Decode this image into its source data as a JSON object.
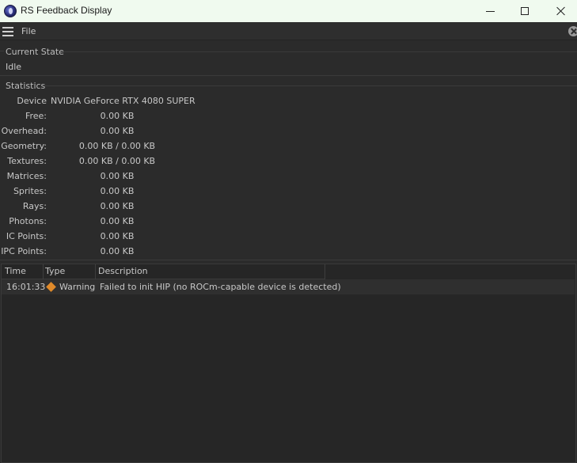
{
  "window": {
    "title": "RS Feedback Display",
    "app_icon": "cinema4d-icon"
  },
  "menubar": {
    "menu_icon": "hamburger-icon",
    "file_label": "File",
    "close_icon": "close-circle-icon"
  },
  "current_state": {
    "label": "Current State",
    "value": "Idle"
  },
  "statistics": {
    "label": "Statistics",
    "device_label": "Device",
    "device_value": "NVIDIA GeForce RTX 4080 SUPER",
    "rows": [
      {
        "label": "Free:",
        "value": "0.00 KB"
      },
      {
        "label": "Overhead:",
        "value": "0.00 KB"
      },
      {
        "label": "Geometry:",
        "value": "0.00 KB / 0.00 KB"
      },
      {
        "label": "Textures:",
        "value": "0.00 KB / 0.00 KB"
      },
      {
        "label": "Matrices:",
        "value": "0.00 KB"
      },
      {
        "label": "Sprites:",
        "value": "0.00 KB"
      },
      {
        "label": "Rays:",
        "value": "0.00 KB"
      },
      {
        "label": "Photons:",
        "value": "0.00 KB"
      },
      {
        "label": "IC Points:",
        "value": "0.00 KB"
      },
      {
        "label": "IPC Points:",
        "value": "0.00 KB"
      }
    ]
  },
  "log": {
    "columns": [
      "Time",
      "Type",
      "Description"
    ],
    "rows": [
      {
        "time": "16:01:33",
        "type": "Warning",
        "type_icon": "warning-diamond-icon",
        "description": "Failed to init HIP (no ROCm-capable device is detected)"
      }
    ]
  },
  "colors": {
    "titlebar_bg": "#f0faef",
    "panel_bg": "#2b2b2b",
    "warning": "#e08a2a"
  }
}
